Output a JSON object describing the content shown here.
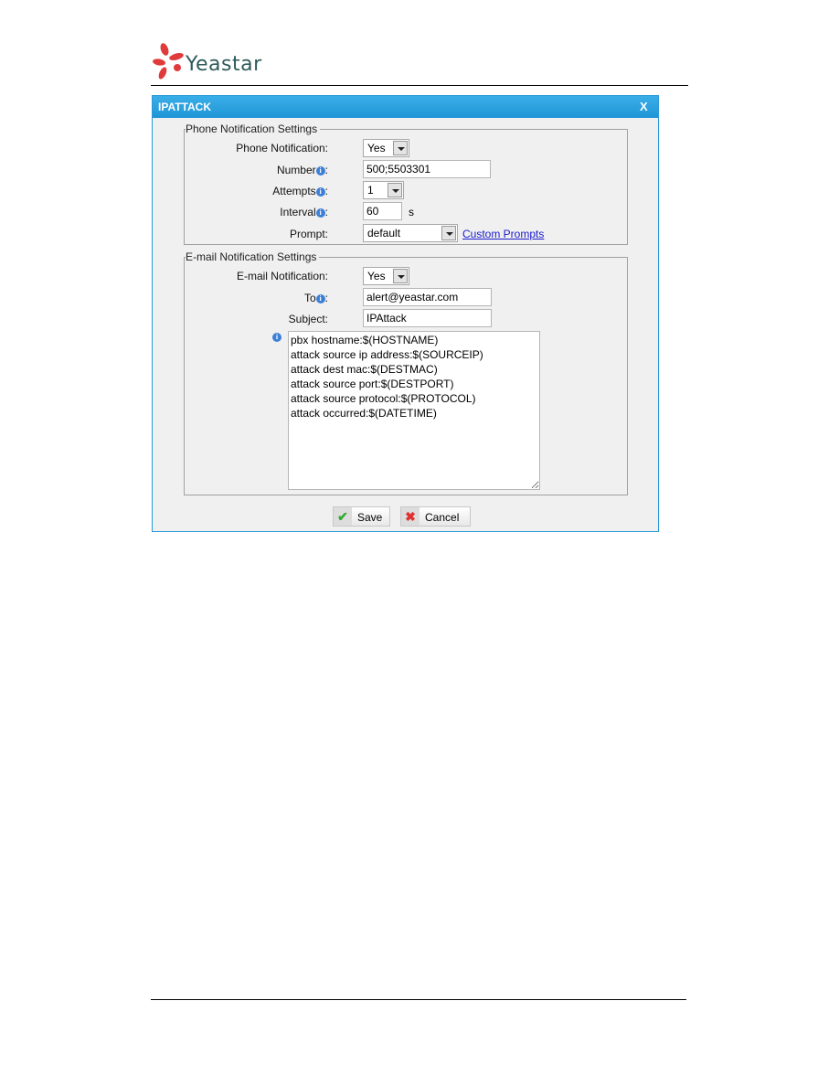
{
  "brand": {
    "name": "Yeastar"
  },
  "dialog": {
    "title": "IPATTACK",
    "close_label": "X"
  },
  "phone": {
    "legend": "Phone Notification Settings",
    "notification_label": "Phone Notification:",
    "notification_value": "Yes",
    "number_label": "Number",
    "number_value": "500;5503301",
    "attempts_label": "Attempts",
    "attempts_value": "1",
    "interval_label": "Interval",
    "interval_value": "60",
    "interval_unit": "s",
    "prompt_label": "Prompt:",
    "prompt_value": "default",
    "custom_prompts_link": "Custom Prompts"
  },
  "email": {
    "legend": "E-mail Notification Settings",
    "notification_label": "E-mail Notification:",
    "notification_value": "Yes",
    "to_label": "To",
    "to_value": "alert@yeastar.com",
    "subject_label": "Subject:",
    "subject_value": "IPAttack",
    "body": "pbx hostname:$(HOSTNAME)\nattack source ip address:$(SOURCEIP)\nattack dest mac:$(DESTMAC)\nattack source port:$(DESTPORT)\nattack source protocol:$(PROTOCOL)\nattack occurred:$(DATETIME)"
  },
  "buttons": {
    "save": "Save",
    "cancel": "Cancel"
  },
  "colors": {
    "titlebar": "#1e95d6",
    "link": "#1a1acc",
    "logo": "#e03030"
  }
}
